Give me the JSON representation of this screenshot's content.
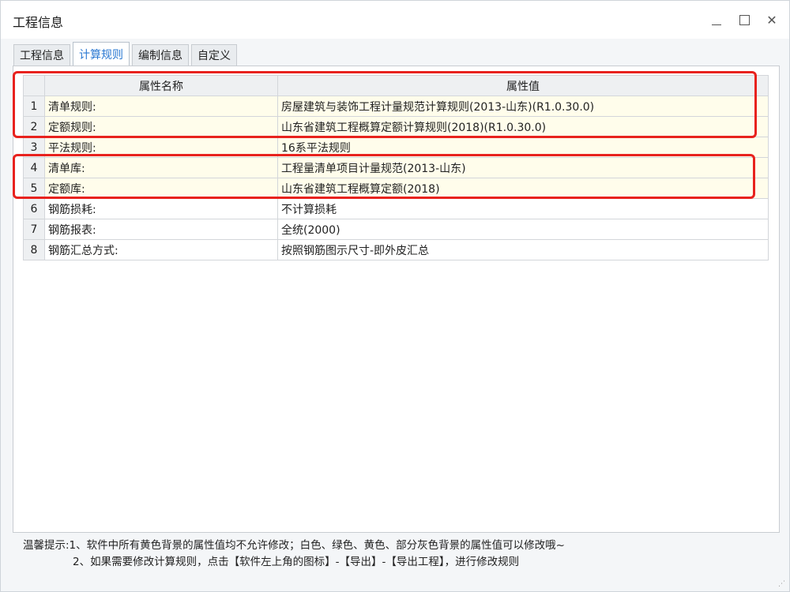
{
  "window": {
    "title": "工程信息",
    "minimize_label": "–",
    "close_label": "✕"
  },
  "tabs": [
    {
      "label": "工程信息",
      "active": false
    },
    {
      "label": "计算规则",
      "active": true
    },
    {
      "label": "编制信息",
      "active": false
    },
    {
      "label": "自定义",
      "active": false
    }
  ],
  "table": {
    "headers": {
      "name": "属性名称",
      "value": "属性值"
    },
    "rows": [
      {
        "num": "1",
        "name": "清单规则:",
        "value": "房屋建筑与装饰工程计量规范计算规则(2013-山东)(R1.0.30.0)",
        "bg": "yellow"
      },
      {
        "num": "2",
        "name": "定额规则:",
        "value": "山东省建筑工程概算定额计算规则(2018)(R1.0.30.0)",
        "bg": "yellow"
      },
      {
        "num": "3",
        "name": "平法规则:",
        "value": "16系平法规则",
        "bg": "yellow"
      },
      {
        "num": "4",
        "name": "清单库:",
        "value": "工程量清单项目计量规范(2013-山东)",
        "bg": "yellow"
      },
      {
        "num": "5",
        "name": "定额库:",
        "value": "山东省建筑工程概算定额(2018)",
        "bg": "yellow"
      },
      {
        "num": "6",
        "name": "钢筋损耗:",
        "value": "不计算损耗",
        "bg": "white"
      },
      {
        "num": "7",
        "name": "钢筋报表:",
        "value": "全统(2000)",
        "bg": "white"
      },
      {
        "num": "8",
        "name": "钢筋汇总方式:",
        "value": "按照钢筋图示尺寸-即外皮汇总",
        "bg": "white"
      }
    ]
  },
  "footer": {
    "line1": "温馨提示:1、软件中所有黄色背景的属性值均不允许修改；白色、绿色、黄色、部分灰色背景的属性值可以修改哦~",
    "line2": "2、如果需要修改计算规则，点击【软件左上角的图标】-【导出】-【导出工程】，进行修改规则"
  },
  "colors": {
    "active_tab": "#2a78d2",
    "readonly_bg": "#fffdeb",
    "highlight": "#e8221e"
  }
}
